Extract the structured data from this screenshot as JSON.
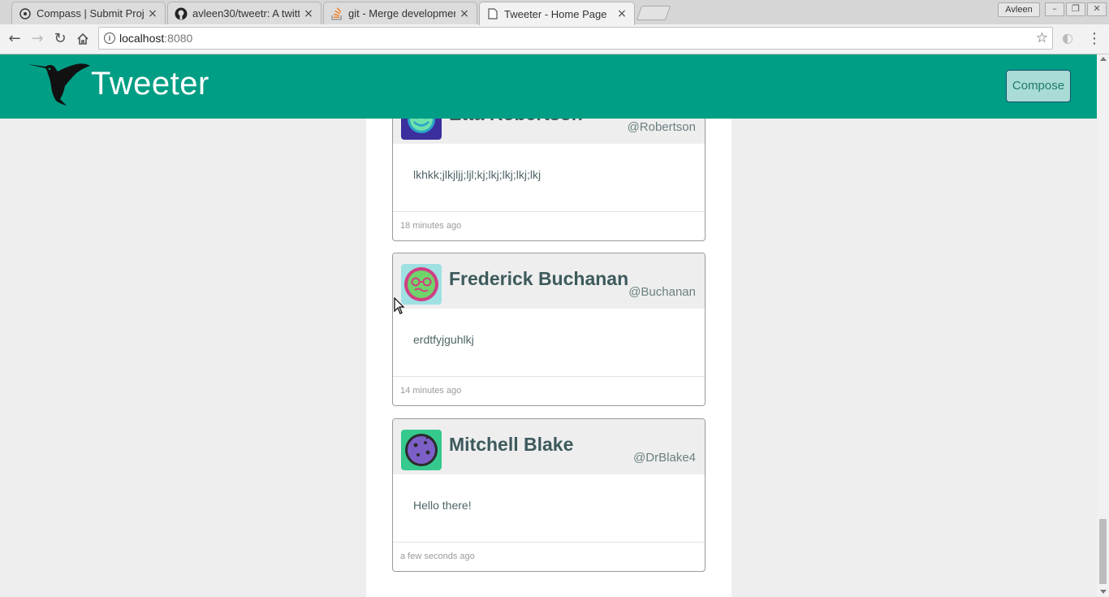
{
  "browser": {
    "tabs": [
      {
        "title": "Compass | Submit Proje",
        "icon": "compass-icon",
        "close": "×"
      },
      {
        "title": "avleen30/tweetr: A twitt",
        "icon": "github-icon",
        "close": "×"
      },
      {
        "title": "git - Merge developmen",
        "icon": "stackoverflow-icon",
        "close": "×"
      },
      {
        "title": "Tweeter - Home Page",
        "icon": "page-icon",
        "close": "×"
      }
    ],
    "profile_name": "Avleen",
    "url_host": "localhost",
    "url_port": ":8080"
  },
  "app": {
    "brand": "Tweeter",
    "compose_label": "Compose",
    "header_color": "#009e84"
  },
  "tweets": [
    {
      "name": "Etta Robertson",
      "handle": "@Robertson",
      "text": "lkhkk;jlkjljj;ljl;kj;lkj;lkj;lkj;lkj",
      "time": "18 minutes ago",
      "avatar_icon": "smiley-avatar-icon"
    },
    {
      "name": "Frederick Buchanan",
      "handle": "@Buchanan",
      "text": "erdtfyjguhlkj",
      "time": "14 minutes ago",
      "avatar_icon": "nerd-face-avatar-icon"
    },
    {
      "name": "Mitchell Blake",
      "handle": "@DrBlake4",
      "text": "Hello there!",
      "time": "a few seconds ago",
      "avatar_icon": "cookie-face-avatar-icon"
    }
  ]
}
